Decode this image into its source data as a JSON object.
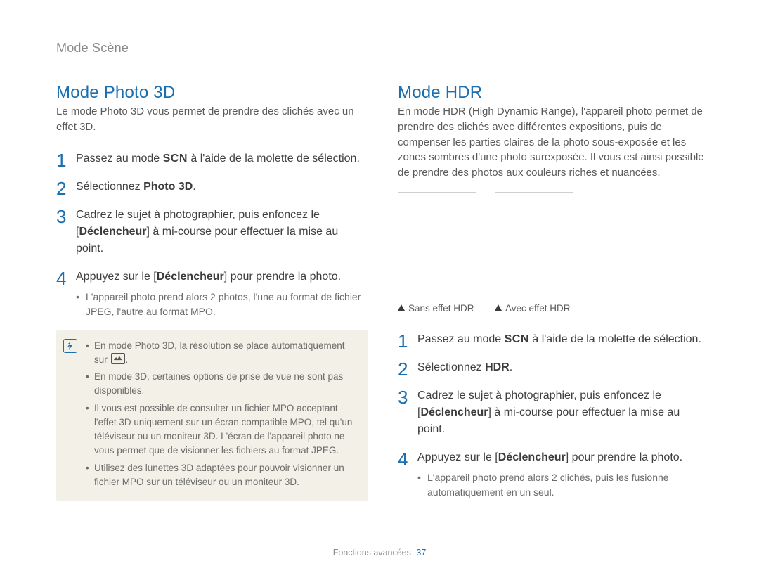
{
  "breadcrumb": "Mode Scène",
  "left": {
    "title": "Mode Photo 3D",
    "intro": "Le mode Photo 3D vous permet de prendre des clichés avec un effet 3D.",
    "scn_label": "SCN",
    "steps": {
      "s1_a": "Passez au mode ",
      "s1_b": " à l'aide de la molette de sélection.",
      "s2_a": "Sélectionnez ",
      "s2_bold": "Photo 3D",
      "s2_b": ".",
      "s3_a": "Cadrez le sujet à photographier, puis enfoncez le [",
      "s3_bold": "Déclencheur",
      "s3_b": "] à mi-course pour effectuer la mise au point.",
      "s4_a": "Appuyez sur le [",
      "s4_bold": "Déclencheur",
      "s4_b": "] pour prendre la photo.",
      "s4_sub1": "L'appareil photo prend alors 2 photos, l'une au format de fichier JPEG, l'autre au format MPO."
    },
    "note": {
      "n1_a": "En mode Photo 3D, la résolution se place automatiquement sur ",
      "n1_b": ".",
      "n2": "En mode 3D, certaines options de prise de vue ne sont pas disponibles.",
      "n3": "Il vous est possible de consulter un fichier MPO acceptant l'effet 3D uniquement sur un écran compatible MPO, tel qu'un téléviseur ou un moniteur 3D. L'écran de l'appareil photo ne vous permet que de visionner les fichiers au format JPEG.",
      "n4": "Utilisez des lunettes 3D adaptées pour pouvoir visionner un fichier MPO sur un téléviseur ou un moniteur 3D."
    }
  },
  "right": {
    "title": "Mode HDR",
    "intro": "En mode HDR (High Dynamic Range), l'appareil photo permet de prendre des clichés avec différentes expositions, puis de compenser les parties claires de la photo sous-exposée et les zones sombres d'une photo surexposée. Il vous est ainsi possible de prendre des photos aux couleurs riches et nuancées.",
    "captions": {
      "c1": "Sans effet HDR",
      "c2": "Avec effet HDR"
    },
    "scn_label": "SCN",
    "steps": {
      "s1_a": "Passez au mode ",
      "s1_b": " à l'aide de la molette de sélection.",
      "s2_a": "Sélectionnez ",
      "s2_bold": "HDR",
      "s2_b": ".",
      "s3_a": "Cadrez le sujet à photographier, puis enfoncez le [",
      "s3_bold": "Déclencheur",
      "s3_b": "] à mi-course pour effectuer la mise au point.",
      "s4_a": "Appuyez sur le [",
      "s4_bold": "Déclencheur",
      "s4_b": "] pour prendre la photo.",
      "s4_sub1": "L'appareil photo prend alors 2 clichés, puis les fusionne automatiquement en un seul."
    }
  },
  "footer": {
    "label": "Fonctions avancées",
    "page": "37"
  }
}
